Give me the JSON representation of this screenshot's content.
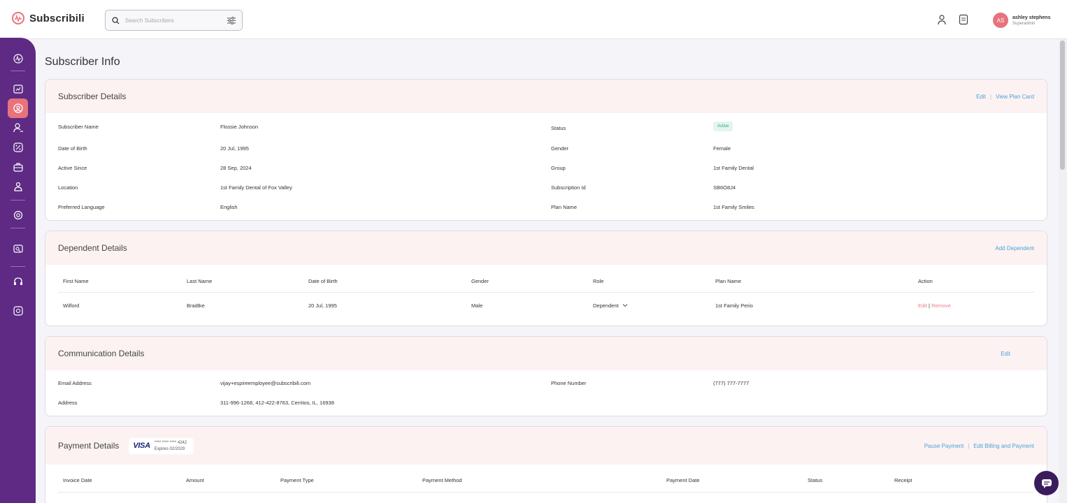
{
  "brand": {
    "name": "Subscribili"
  },
  "search": {
    "placeholder": "Search Subscribers"
  },
  "user": {
    "initials": "AS",
    "name": "ashley stephens",
    "role": "Superadmin"
  },
  "page": {
    "title": "Subscriber Info"
  },
  "subscriber": {
    "title": "Subscriber Details",
    "edit_label": "Edit",
    "view_plan_label": "View Plan Card",
    "left": [
      {
        "label": "Subscriber Name",
        "value": "Flossie Johnson"
      },
      {
        "label": "Date of Birth",
        "value": "20 Jul, 1995"
      },
      {
        "label": "Active Since",
        "value": "28 Sep, 2024"
      },
      {
        "label": "Location",
        "value": "1st Family Dental of Fox Valley"
      },
      {
        "label": "Preferred Language",
        "value": "English"
      }
    ],
    "right": [
      {
        "label": "Status",
        "value": "Active"
      },
      {
        "label": "Gender",
        "value": "Female"
      },
      {
        "label": "Group",
        "value": "1st Family Dental"
      },
      {
        "label": "Subscription Id",
        "value": "SB6O8J4"
      },
      {
        "label": "Plan Name",
        "value": "1st Family Smiles"
      }
    ]
  },
  "dependent": {
    "title": "Dependent Details",
    "add_label": "Add Dependent",
    "columns": [
      "First Name",
      "Last Name",
      "Date of Birth",
      "Gender",
      "Role",
      "Plan Name",
      "Action"
    ],
    "rows": [
      {
        "first_name": "Wilford",
        "last_name": "Bradtke",
        "dob": "20 Jul, 1995",
        "gender": "Male",
        "role": "Dependent",
        "plan": "1st Family Perio",
        "edit": "Edit",
        "sep": "|",
        "remove": "Remove"
      }
    ]
  },
  "communication": {
    "title": "Communication Details",
    "edit_label": "Edit",
    "email_label": "Email Address",
    "email": "vijay+espireemployee@subscribili.com",
    "phone_label": "Phone Number",
    "phone": "(777) 777-7777",
    "address_label": "Address",
    "address": "311-996-1268, 412-422-8763, Cerritos, IL, 16938"
  },
  "payment": {
    "title": "Payment Details",
    "card_brand": "VISA",
    "card_number": "**** **** **** 4242",
    "card_expiry": "Expires 02/2029",
    "pause_label": "Pause Payment",
    "edit_billing_label": "Edit Billing and Payment",
    "columns": [
      "Invoice Date",
      "Amount",
      "Payment Type",
      "Payment Method",
      "Payment Date",
      "Status",
      "Receipt"
    ]
  },
  "colors": {
    "sidebar": "#5e2a84",
    "accent": "#e8737c",
    "link": "#4aa3d9",
    "header_tint": "#fdf2f2"
  }
}
